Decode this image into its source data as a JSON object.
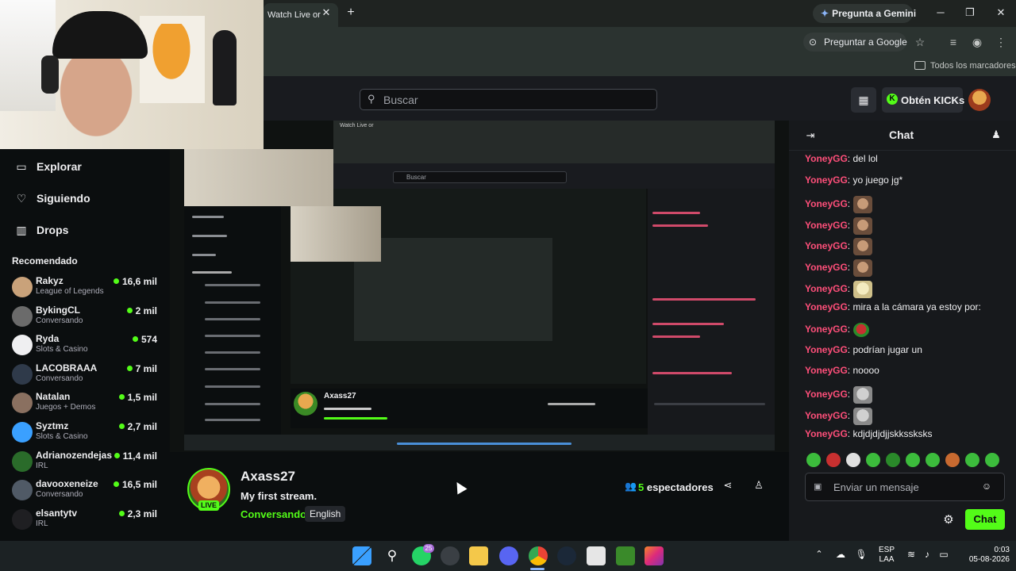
{
  "browser": {
    "tab_title": "Watch Live or",
    "gemini_label": "Pregunta a Gemini",
    "ask_google_label": "Preguntar a Google",
    "bookmarks_label": "Todos los marcadores"
  },
  "header": {
    "search_placeholder": "Buscar",
    "kicks_label": "Obtén KICKs"
  },
  "sidebar": {
    "nav": [
      {
        "label": "Explorar",
        "icon": "compass-icon"
      },
      {
        "label": "Siguiendo",
        "icon": "heart-icon"
      },
      {
        "label": "Drops",
        "icon": "drops-icon"
      }
    ],
    "recommended_title": "Recomendado",
    "recommended": [
      {
        "name": "Rakyz",
        "category": "League of Legends",
        "viewers": "16,6 mil",
        "color": "#c9a27a"
      },
      {
        "name": "BykingCL",
        "category": "Conversando",
        "viewers": "2 mil",
        "color": "#6b6b6b"
      },
      {
        "name": "Ryda",
        "category": "Slots & Casino",
        "viewers": "574",
        "color": "#efeff1"
      },
      {
        "name": "LACOBRAAA",
        "category": "Conversando",
        "viewers": "7 mil",
        "color": "#2f3a4a"
      },
      {
        "name": "Natalan",
        "category": "Juegos + Demos",
        "viewers": "1,5 mil",
        "color": "#8a7060"
      },
      {
        "name": "Syztmz",
        "category": "Slots & Casino",
        "viewers": "2,7 mil",
        "color": "#3aa0ff"
      },
      {
        "name": "Adrianozendejas",
        "category": "IRL",
        "viewers": "11,4 mil",
        "color": "#2a6b2a"
      },
      {
        "name": "davooxeneize",
        "category": "Conversando",
        "viewers": "16,5 mil",
        "color": "#505a66"
      },
      {
        "name": "elsantytv",
        "category": "IRL",
        "viewers": "2,3 mil",
        "color": "#1f1f22"
      }
    ]
  },
  "stream": {
    "streamer": "Axass27",
    "live_label": "LIVE",
    "title": "My first stream.",
    "category": "Conversando",
    "language": "English",
    "viewers_count": "5",
    "viewers_label": "espectadores"
  },
  "chat": {
    "title": "Chat",
    "messages": [
      {
        "user": "YoneyGG",
        "text": ": del lol",
        "emote": ""
      },
      {
        "user": "YoneyGG",
        "text": ": yo juego jg*",
        "emote": ""
      },
      {
        "user": "YoneyGG",
        "text": ":",
        "emote": "catjam"
      },
      {
        "user": "YoneyGG",
        "text": ":",
        "emote": "catjam"
      },
      {
        "user": "YoneyGG",
        "text": ":",
        "emote": "catjam"
      },
      {
        "user": "YoneyGG",
        "text": ":",
        "emote": "catjam"
      },
      {
        "user": "YoneyGG",
        "text": ":",
        "emote": "anime"
      },
      {
        "user": "YoneyGG",
        "text": ": mira a la cámara ya estoy por:",
        "emote": ""
      },
      {
        "user": "YoneyGG",
        "text": ":",
        "emote": "green"
      },
      {
        "user": "YoneyGG",
        "text": ": podrían jugar un",
        "emote": ""
      },
      {
        "user": "YoneyGG",
        "text": ": noooo",
        "emote": ""
      },
      {
        "user": "YoneyGG",
        "text": ":",
        "emote": "gray"
      },
      {
        "user": "YoneyGG",
        "text": ":",
        "emote": "gray"
      },
      {
        "user": "YoneyGG",
        "text": ": kdjdjdjdjjskkssksks",
        "emote": ""
      }
    ],
    "input_placeholder": "Enviar un mensaje",
    "send_label": "Chat"
  },
  "nested": {
    "search_placeholder": "Buscar",
    "streamer": "Axass27"
  },
  "taskbar": {
    "whatsapp_badge": "25",
    "lang_line1": "ESP",
    "lang_line2": "LAA",
    "time": "0:03",
    "date": "05-08-2026"
  },
  "colors": {
    "kick_green": "#53fc18",
    "chat_username": "#ff4f7a",
    "panel_bg": "#17191c",
    "page_bg": "#0b0e0f"
  }
}
